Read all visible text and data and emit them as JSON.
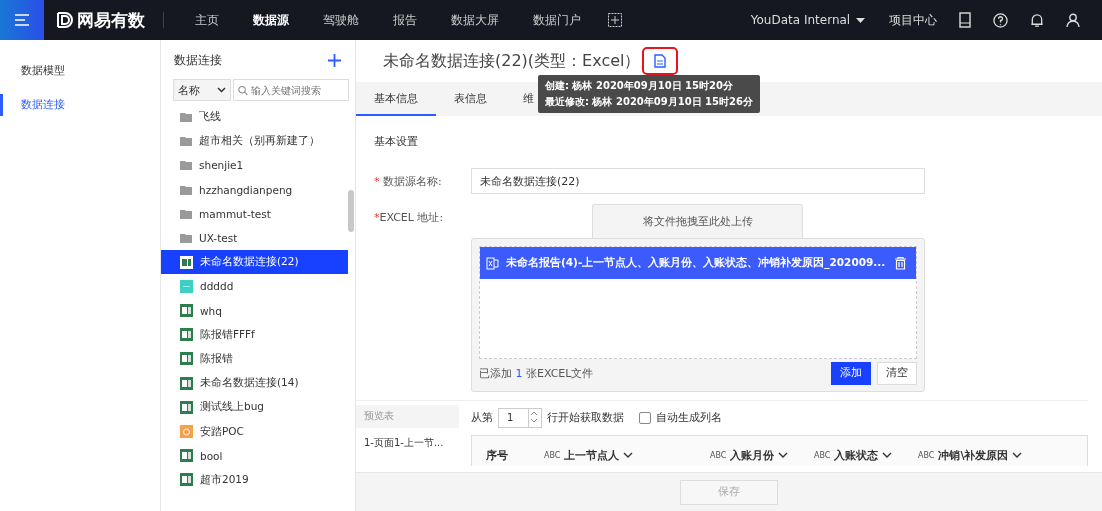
{
  "topbar": {
    "logo": "网易有数",
    "nav": [
      {
        "label": "主页",
        "selected": false
      },
      {
        "label": "数据源",
        "selected": true
      },
      {
        "label": "驾驶舱",
        "selected": false
      },
      {
        "label": "报告",
        "selected": false
      },
      {
        "label": "数据大屏",
        "selected": false
      },
      {
        "label": "数据门户",
        "selected": false
      }
    ],
    "workspace": "YouData Internal",
    "project_center": "项目中心"
  },
  "sidebar": {
    "items": [
      {
        "label": "数据模型",
        "selected": false
      },
      {
        "label": "数据连接",
        "selected": true
      }
    ]
  },
  "connections": {
    "title": "数据连接",
    "filter": "名称",
    "search": {
      "placeholder": "输入关键词搜索"
    },
    "items": [
      {
        "kind": "folder",
        "label": "飞线",
        "selected": false
      },
      {
        "kind": "folder",
        "label": "超市相关（别再新建了）",
        "selected": false
      },
      {
        "kind": "folder",
        "label": "shenjie1",
        "selected": false
      },
      {
        "kind": "folder",
        "label": "hzzhangdianpeng",
        "selected": false
      },
      {
        "kind": "folder",
        "label": "mammut-test",
        "selected": false
      },
      {
        "kind": "folder",
        "label": "UX-test",
        "selected": false
      },
      {
        "kind": "excel",
        "label": "未命名数据连接(22)",
        "selected": true
      },
      {
        "kind": "teal",
        "label": "ddddd",
        "selected": false
      },
      {
        "kind": "excel",
        "label": "whq",
        "selected": false
      },
      {
        "kind": "excel",
        "label": "陈报错FFFf",
        "selected": false
      },
      {
        "kind": "excel",
        "label": "陈报错",
        "selected": false
      },
      {
        "kind": "excel",
        "label": "未命名数据连接(14)",
        "selected": false
      },
      {
        "kind": "excel",
        "label": "测试线上bug",
        "selected": false
      },
      {
        "kind": "orange",
        "label": "安踏POC",
        "selected": false
      },
      {
        "kind": "excel",
        "label": "bool",
        "selected": false
      },
      {
        "kind": "excel",
        "label": "超市2019",
        "selected": false
      }
    ]
  },
  "detail": {
    "title": "未命名数据连接(22)(类型：Excel）",
    "tooltip": [
      "创建: 杨林 2020年09月10日 15时20分",
      "最近修改: 杨林 2020年09月10日 15时26分"
    ],
    "tabs": [
      {
        "label": "基本信息",
        "selected": true
      },
      {
        "label": "表信息",
        "selected": false
      },
      {
        "label": "维",
        "selected": false
      }
    ],
    "section": "基本设置",
    "required_mark": "*",
    "name_label": "数据源名称:",
    "name_value": "未命名数据连接(22)",
    "excel_label": "EXCEL 地址:",
    "upload_hint": "将文件拖拽至此处上传",
    "file": "未命名报告(4)-上一节点人、入账月份、入账状态、冲销补发原因_202009...",
    "added_prefix": "已添加",
    "added_count": "1",
    "added_suffix": "张EXCEL文件",
    "add_button": "添加",
    "clear_button": "清空",
    "preview_title": "预览表",
    "preview_sheet": "1-页面1-上一节...",
    "row_prefix": "从第",
    "row_value": "1",
    "row_suffix": "行开始获取数据",
    "auto_header": {
      "label": "自动生成列名",
      "checked": false
    },
    "columns": [
      {
        "label": "序号"
      },
      {
        "label": "上一节点人",
        "type": "ABC"
      },
      {
        "label": "入账月份",
        "type": "ABC"
      },
      {
        "label": "入账状态",
        "type": "ABC"
      },
      {
        "label": "冲销\\补发原因",
        "type": "ABC"
      }
    ],
    "save_button": "保存"
  }
}
